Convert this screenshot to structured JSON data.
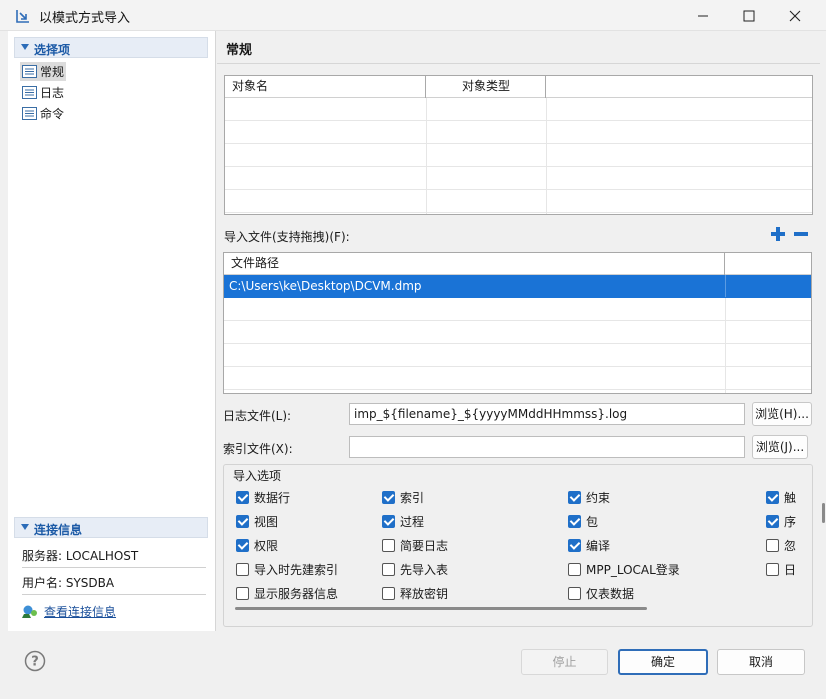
{
  "window": {
    "title": "以模式方式导入",
    "minimize_icon": "minimize-icon",
    "maximize_icon": "maximize-icon",
    "close_icon": "close-icon"
  },
  "sidebar": {
    "select_section": "选择项",
    "items": [
      {
        "label": "常规",
        "selected": true,
        "icon": "list-icon"
      },
      {
        "label": "日志",
        "selected": false,
        "icon": "list-icon"
      },
      {
        "label": "命令",
        "selected": false,
        "icon": "list-icon"
      }
    ],
    "connection_section": "连接信息",
    "server": "服务器: LOCALHOST",
    "username": "用户名: SYSDBA",
    "view_connection": "查看连接信息"
  },
  "main": {
    "title": "常规",
    "object_table": {
      "columns": [
        "对象名",
        "对象类型"
      ],
      "rows": []
    },
    "import_file_label": "导入文件(支持拖拽)(F):",
    "add_icon": "plus-icon",
    "remove_icon": "minus-icon",
    "file_table": {
      "columns": [
        "文件路径"
      ],
      "rows": [
        "C:\\Users\\ke\\Desktop\\DCVM.dmp"
      ]
    },
    "log_file_label": "日志文件(L):",
    "log_file_value": "imp_${filename}_${yyyyMMddHHmmss}.log",
    "browse_log": "浏览(H)...",
    "index_file_label": "索引文件(X):",
    "index_file_value": "",
    "browse_index": "浏览(J)...",
    "options_title": "导入选项",
    "options": [
      {
        "label": "数据行",
        "checked": true
      },
      {
        "label": "索引",
        "checked": true
      },
      {
        "label": "约束",
        "checked": true
      },
      {
        "label": "触",
        "checked": true
      },
      {
        "label": "视图",
        "checked": true
      },
      {
        "label": "过程",
        "checked": true
      },
      {
        "label": "包",
        "checked": true
      },
      {
        "label": "序",
        "checked": true
      },
      {
        "label": "权限",
        "checked": true
      },
      {
        "label": "简要日志",
        "checked": false
      },
      {
        "label": "编译",
        "checked": true
      },
      {
        "label": "忽",
        "checked": false
      },
      {
        "label": "导入时先建索引",
        "checked": false
      },
      {
        "label": "先导入表",
        "checked": false
      },
      {
        "label": "MPP_LOCAL登录",
        "checked": false
      },
      {
        "label": "日",
        "checked": false
      },
      {
        "label": "显示服务器信息",
        "checked": false
      },
      {
        "label": "释放密钥",
        "checked": false
      },
      {
        "label": "仅表数据",
        "checked": false
      }
    ]
  },
  "footer": {
    "help_icon": "help-icon",
    "stop": "停止",
    "ok": "确定",
    "cancel": "取消"
  },
  "colors": {
    "accent": "#1f6fc8",
    "selection": "#1a73d6",
    "section_header_text": "#1c5aa6"
  }
}
